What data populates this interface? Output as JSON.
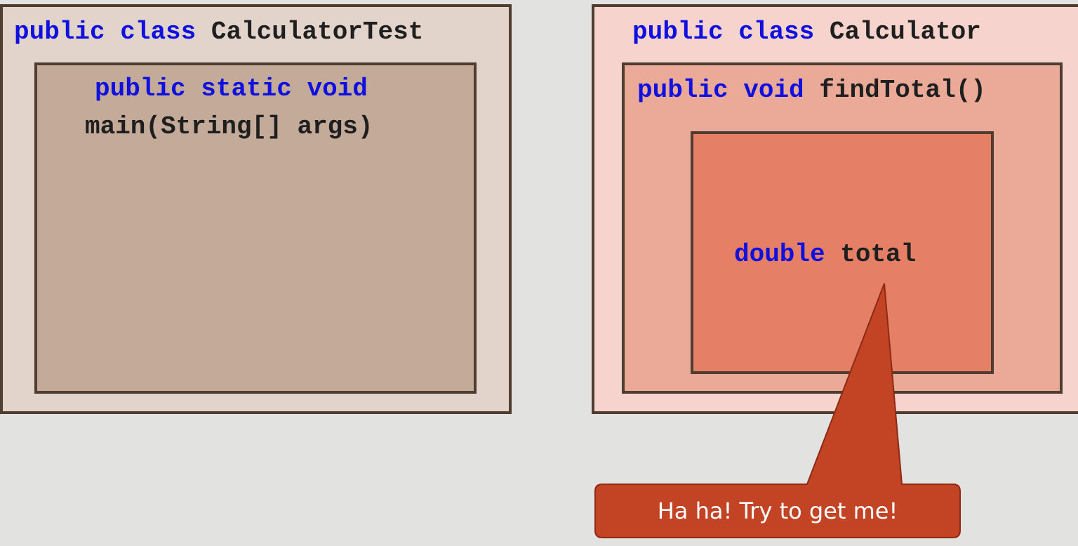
{
  "calculator_test": {
    "class_kw_public": "public",
    "class_kw_class": "class",
    "class_name": "CalculatorTest",
    "method": {
      "kw_public": "public",
      "kw_static": "static",
      "kw_void": "void",
      "signature": "main(String[] args)"
    }
  },
  "calculator": {
    "class_kw_public": "public",
    "class_kw_class": "class",
    "class_name": "Calculator",
    "method": {
      "kw_public": "public",
      "kw_void": "void",
      "signature": "findTotal()"
    },
    "variable": {
      "type": "double",
      "name": "total"
    }
  },
  "callout": {
    "text": "Ha ha! Try to get me!"
  },
  "colors": {
    "keyword": "#0f10e0",
    "border": "#503d31",
    "callout_fill": "#c24424",
    "background": "#e2e2e1"
  }
}
